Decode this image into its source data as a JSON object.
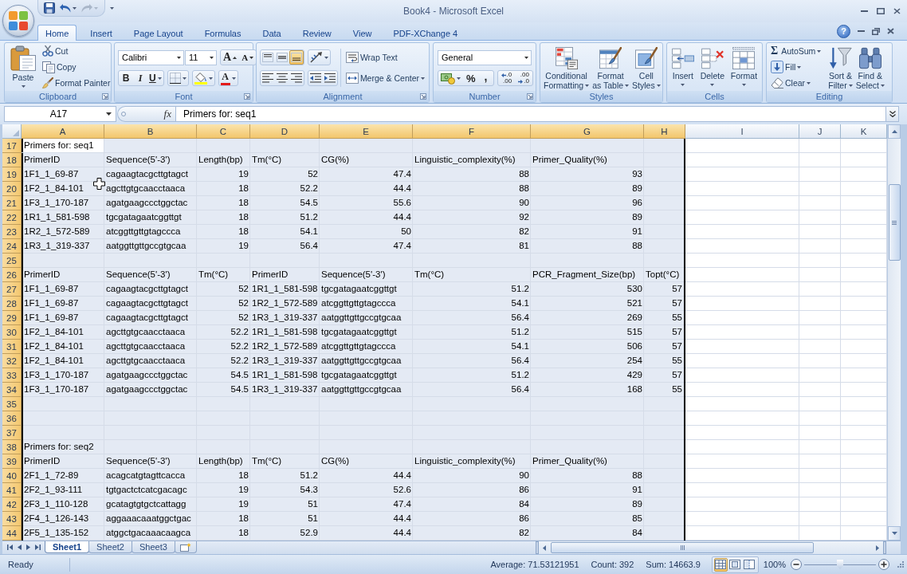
{
  "title_bar": {
    "title": "Book4 - Microsoft Excel"
  },
  "ribbon": {
    "tabs": [
      {
        "label": "Home",
        "selected": true
      },
      {
        "label": "Insert",
        "selected": false
      },
      {
        "label": "Page Layout",
        "selected": false
      },
      {
        "label": "Formulas",
        "selected": false
      },
      {
        "label": "Data",
        "selected": false
      },
      {
        "label": "Review",
        "selected": false
      },
      {
        "label": "View",
        "selected": false
      },
      {
        "label": "PDF-XChange 4",
        "selected": false
      }
    ],
    "help": "?",
    "groups": [
      {
        "kind": "clipboard",
        "label": "Clipboard",
        "paste": "Paste",
        "buttons": [
          {
            "kind": "cut",
            "label": "Cut"
          },
          {
            "kind": "copy",
            "label": "Copy"
          },
          {
            "kind": "painter",
            "label": "Format Painter"
          }
        ]
      },
      {
        "kind": "font",
        "label": "Font",
        "font_name": "Calibri",
        "font_size": "11",
        "grow_font": "A",
        "shrink_font": "A",
        "bold": "B",
        "italic": "I",
        "underline": "U",
        "font_color": "A"
      },
      {
        "kind": "alignment",
        "label": "Alignment",
        "vertical": [
          {
            "kind": "top",
            "selected": false
          },
          {
            "kind": "middle",
            "selected": false
          },
          {
            "kind": "bottom",
            "selected": true
          }
        ],
        "horizontal": [
          {
            "kind": "left",
            "selected": false
          },
          {
            "kind": "center",
            "selected": false
          },
          {
            "kind": "right",
            "selected": false
          }
        ],
        "wrap_text": "Wrap Text",
        "merge": "Merge & Center"
      },
      {
        "kind": "number",
        "label": "Number",
        "format": "General",
        "percent": "%",
        "comma": ",",
        "increase_decimal": [
          ".0",
          ".00"
        ],
        "decrease_decimal": [
          ".00",
          ".0"
        ]
      },
      {
        "kind": "styles",
        "label": "Styles",
        "buttons": [
          {
            "kind": "conditional",
            "lines": [
              "Conditional",
              "Formatting"
            ]
          },
          {
            "kind": "table",
            "lines": [
              "Format",
              "as Table"
            ]
          },
          {
            "kind": "cellstyles",
            "lines": [
              "Cell",
              "Styles"
            ]
          }
        ]
      },
      {
        "kind": "cells",
        "label": "Cells",
        "buttons": [
          {
            "kind": "insert",
            "label": "Insert"
          },
          {
            "kind": "delete",
            "label": "Delete"
          },
          {
            "kind": "format",
            "label": "Format"
          }
        ]
      },
      {
        "kind": "editing",
        "label": "Editing",
        "buttons": [
          {
            "kind": "autosum",
            "symbol": "Σ",
            "label": "AutoSum"
          },
          {
            "kind": "fill",
            "label": "Fill"
          },
          {
            "kind": "clear",
            "label": "Clear"
          }
        ],
        "big_buttons": [
          {
            "kind": "sort",
            "lines": [
              "Sort &",
              "Filter"
            ]
          },
          {
            "kind": "find",
            "lines": [
              "Find &",
              "Select"
            ]
          }
        ]
      }
    ]
  },
  "formula_bar": {
    "name_box": "A17",
    "function_label": "fx",
    "formula": "Primers for: seq1"
  },
  "sheet": {
    "columns": [
      {
        "label": "A",
        "selected": true,
        "active": true
      },
      {
        "label": "B",
        "selected": true,
        "active": false
      },
      {
        "label": "C",
        "selected": true,
        "active": false
      },
      {
        "label": "D",
        "selected": true,
        "active": false
      },
      {
        "label": "E",
        "selected": true,
        "active": false
      },
      {
        "label": "F",
        "selected": true,
        "active": false
      },
      {
        "label": "G",
        "selected": true,
        "active": false
      },
      {
        "label": "H",
        "selected": true,
        "active": false
      },
      {
        "label": "I",
        "selected": false,
        "active": false
      },
      {
        "label": "J",
        "selected": false,
        "active": false
      },
      {
        "label": "K",
        "selected": false,
        "active": false
      }
    ],
    "rows": [
      {
        "number": "17",
        "selected": true,
        "active": true,
        "cells": [
          {
            "text": "Primers for: seq1",
            "kind": "text"
          }
        ]
      },
      {
        "number": "18",
        "selected": true,
        "active": false,
        "cells": [
          {
            "text": "PrimerID",
            "kind": "text"
          },
          {
            "text": "Sequence(5'-3')",
            "kind": "text"
          },
          {
            "text": "Length(bp)",
            "kind": "text"
          },
          {
            "text": "Tm(°C)",
            "kind": "text"
          },
          {
            "text": "CG(%)",
            "kind": "text"
          },
          {
            "text": "Linguistic_complexity(%)",
            "kind": "text"
          },
          {
            "text": "Primer_Quality(%)",
            "kind": "text"
          }
        ]
      },
      {
        "number": "19",
        "selected": true,
        "active": false,
        "cells": [
          {
            "text": "1F1_1_69-87",
            "kind": "text"
          },
          {
            "text": "cagaagtacgcttgtagct",
            "kind": "text"
          },
          {
            "text": "19",
            "kind": "number"
          },
          {
            "text": "52",
            "kind": "number"
          },
          {
            "text": "47.4",
            "kind": "number"
          },
          {
            "text": "88",
            "kind": "number"
          },
          {
            "text": "93",
            "kind": "number"
          }
        ]
      },
      {
        "number": "20",
        "selected": true,
        "active": false,
        "cells": [
          {
            "text": "1F2_1_84-101",
            "kind": "text"
          },
          {
            "text": "agcttgtgcaacctaaca",
            "kind": "text"
          },
          {
            "text": "18",
            "kind": "number"
          },
          {
            "text": "52.2",
            "kind": "number"
          },
          {
            "text": "44.4",
            "kind": "number"
          },
          {
            "text": "88",
            "kind": "number"
          },
          {
            "text": "89",
            "kind": "number"
          }
        ]
      },
      {
        "number": "21",
        "selected": true,
        "active": false,
        "cells": [
          {
            "text": "1F3_1_170-187",
            "kind": "text"
          },
          {
            "text": "agatgaagccctggctac",
            "kind": "text"
          },
          {
            "text": "18",
            "kind": "number"
          },
          {
            "text": "54.5",
            "kind": "number"
          },
          {
            "text": "55.6",
            "kind": "number"
          },
          {
            "text": "90",
            "kind": "number"
          },
          {
            "text": "96",
            "kind": "number"
          }
        ]
      },
      {
        "number": "22",
        "selected": true,
        "active": false,
        "cells": [
          {
            "text": "1R1_1_581-598",
            "kind": "text"
          },
          {
            "text": "tgcgatagaatcggttgt",
            "kind": "text"
          },
          {
            "text": "18",
            "kind": "number"
          },
          {
            "text": "51.2",
            "kind": "number"
          },
          {
            "text": "44.4",
            "kind": "number"
          },
          {
            "text": "92",
            "kind": "number"
          },
          {
            "text": "89",
            "kind": "number"
          }
        ]
      },
      {
        "number": "23",
        "selected": true,
        "active": false,
        "cells": [
          {
            "text": "1R2_1_572-589",
            "kind": "text"
          },
          {
            "text": "atcggttgttgtagccca",
            "kind": "text"
          },
          {
            "text": "18",
            "kind": "number"
          },
          {
            "text": "54.1",
            "kind": "number"
          },
          {
            "text": "50",
            "kind": "number"
          },
          {
            "text": "82",
            "kind": "number"
          },
          {
            "text": "91",
            "kind": "number"
          }
        ]
      },
      {
        "number": "24",
        "selected": true,
        "active": false,
        "cells": [
          {
            "text": "1R3_1_319-337",
            "kind": "text"
          },
          {
            "text": "aatggttgttgccgtgcaa",
            "kind": "text"
          },
          {
            "text": "19",
            "kind": "number"
          },
          {
            "text": "56.4",
            "kind": "number"
          },
          {
            "text": "47.4",
            "kind": "number"
          },
          {
            "text": "81",
            "kind": "number"
          },
          {
            "text": "88",
            "kind": "number"
          }
        ]
      },
      {
        "number": "25",
        "selected": true,
        "active": false
      },
      {
        "number": "26",
        "selected": true,
        "active": false,
        "cells": [
          {
            "text": "PrimerID",
            "kind": "text"
          },
          {
            "text": "Sequence(5'-3')",
            "kind": "text"
          },
          {
            "text": "Tm(°C)",
            "kind": "text"
          },
          {
            "text": "PrimerID",
            "kind": "text"
          },
          {
            "text": "Sequence(5'-3')",
            "kind": "text"
          },
          {
            "text": "Tm(°C)",
            "kind": "text"
          },
          {
            "text": "PCR_Fragment_Size(bp)",
            "kind": "text"
          },
          {
            "text": "Topt(°C)",
            "kind": "text"
          }
        ]
      },
      {
        "number": "27",
        "selected": true,
        "active": false,
        "cells": [
          {
            "text": "1F1_1_69-87",
            "kind": "text"
          },
          {
            "text": "cagaagtacgcttgtagct",
            "kind": "text"
          },
          {
            "text": "52",
            "kind": "number"
          },
          {
            "text": "1R1_1_581-598",
            "kind": "text"
          },
          {
            "text": "tgcgatagaatcggttgt",
            "kind": "text"
          },
          {
            "text": "51.2",
            "kind": "number"
          },
          {
            "text": "530",
            "kind": "number"
          },
          {
            "text": "57",
            "kind": "number"
          }
        ]
      },
      {
        "number": "28",
        "selected": true,
        "active": false,
        "cells": [
          {
            "text": "1F1_1_69-87",
            "kind": "text"
          },
          {
            "text": "cagaagtacgcttgtagct",
            "kind": "text"
          },
          {
            "text": "52",
            "kind": "number"
          },
          {
            "text": "1R2_1_572-589",
            "kind": "text"
          },
          {
            "text": "atcggttgttgtagccca",
            "kind": "text"
          },
          {
            "text": "54.1",
            "kind": "number"
          },
          {
            "text": "521",
            "kind": "number"
          },
          {
            "text": "57",
            "kind": "number"
          }
        ]
      },
      {
        "number": "29",
        "selected": true,
        "active": false,
        "cells": [
          {
            "text": "1F1_1_69-87",
            "kind": "text"
          },
          {
            "text": "cagaagtacgcttgtagct",
            "kind": "text"
          },
          {
            "text": "52",
            "kind": "number"
          },
          {
            "text": "1R3_1_319-337",
            "kind": "text"
          },
          {
            "text": "aatggttgttgccgtgcaa",
            "kind": "text"
          },
          {
            "text": "56.4",
            "kind": "number"
          },
          {
            "text": "269",
            "kind": "number"
          },
          {
            "text": "55",
            "kind": "number"
          }
        ]
      },
      {
        "number": "30",
        "selected": true,
        "active": false,
        "cells": [
          {
            "text": "1F2_1_84-101",
            "kind": "text"
          },
          {
            "text": "agcttgtgcaacctaaca",
            "kind": "text"
          },
          {
            "text": "52.2",
            "kind": "number"
          },
          {
            "text": "1R1_1_581-598",
            "kind": "text"
          },
          {
            "text": "tgcgatagaatcggttgt",
            "kind": "text"
          },
          {
            "text": "51.2",
            "kind": "number"
          },
          {
            "text": "515",
            "kind": "number"
          },
          {
            "text": "57",
            "kind": "number"
          }
        ]
      },
      {
        "number": "31",
        "selected": true,
        "active": false,
        "cells": [
          {
            "text": "1F2_1_84-101",
            "kind": "text"
          },
          {
            "text": "agcttgtgcaacctaaca",
            "kind": "text"
          },
          {
            "text": "52.2",
            "kind": "number"
          },
          {
            "text": "1R2_1_572-589",
            "kind": "text"
          },
          {
            "text": "atcggttgttgtagccca",
            "kind": "text"
          },
          {
            "text": "54.1",
            "kind": "number"
          },
          {
            "text": "506",
            "kind": "number"
          },
          {
            "text": "57",
            "kind": "number"
          }
        ]
      },
      {
        "number": "32",
        "selected": true,
        "active": false,
        "cells": [
          {
            "text": "1F2_1_84-101",
            "kind": "text"
          },
          {
            "text": "agcttgtgcaacctaaca",
            "kind": "text"
          },
          {
            "text": "52.2",
            "kind": "number"
          },
          {
            "text": "1R3_1_319-337",
            "kind": "text"
          },
          {
            "text": "aatggttgttgccgtgcaa",
            "kind": "text"
          },
          {
            "text": "56.4",
            "kind": "number"
          },
          {
            "text": "254",
            "kind": "number"
          },
          {
            "text": "55",
            "kind": "number"
          }
        ]
      },
      {
        "number": "33",
        "selected": true,
        "active": false,
        "cells": [
          {
            "text": "1F3_1_170-187",
            "kind": "text"
          },
          {
            "text": "agatgaagccctggctac",
            "kind": "text"
          },
          {
            "text": "54.5",
            "kind": "number"
          },
          {
            "text": "1R1_1_581-598",
            "kind": "text"
          },
          {
            "text": "tgcgatagaatcggttgt",
            "kind": "text"
          },
          {
            "text": "51.2",
            "kind": "number"
          },
          {
            "text": "429",
            "kind": "number"
          },
          {
            "text": "57",
            "kind": "number"
          }
        ]
      },
      {
        "number": "34",
        "selected": true,
        "active": false,
        "cells": [
          {
            "text": "1F3_1_170-187",
            "kind": "text"
          },
          {
            "text": "agatgaagccctggctac",
            "kind": "text"
          },
          {
            "text": "54.5",
            "kind": "number"
          },
          {
            "text": "1R3_1_319-337",
            "kind": "text"
          },
          {
            "text": "aatggttgttgccgtgcaa",
            "kind": "text"
          },
          {
            "text": "56.4",
            "kind": "number"
          },
          {
            "text": "168",
            "kind": "number"
          },
          {
            "text": "55",
            "kind": "number"
          }
        ]
      },
      {
        "number": "35",
        "selected": true,
        "active": false
      },
      {
        "number": "36",
        "selected": true,
        "active": false
      },
      {
        "number": "37",
        "selected": true,
        "active": false
      },
      {
        "number": "38",
        "selected": true,
        "active": false,
        "cells": [
          {
            "text": "Primers for: seq2",
            "kind": "text"
          }
        ]
      },
      {
        "number": "39",
        "selected": true,
        "active": false,
        "cells": [
          {
            "text": "PrimerID",
            "kind": "text"
          },
          {
            "text": "Sequence(5'-3')",
            "kind": "text"
          },
          {
            "text": "Length(bp)",
            "kind": "text"
          },
          {
            "text": "Tm(°C)",
            "kind": "text"
          },
          {
            "text": "CG(%)",
            "kind": "text"
          },
          {
            "text": "Linguistic_complexity(%)",
            "kind": "text"
          },
          {
            "text": "Primer_Quality(%)",
            "kind": "text"
          }
        ]
      },
      {
        "number": "40",
        "selected": true,
        "active": false,
        "cells": [
          {
            "text": "2F1_1_72-89",
            "kind": "text"
          },
          {
            "text": "acagcatgtagttcacca",
            "kind": "text"
          },
          {
            "text": "18",
            "kind": "number"
          },
          {
            "text": "51.2",
            "kind": "number"
          },
          {
            "text": "44.4",
            "kind": "number"
          },
          {
            "text": "90",
            "kind": "number"
          },
          {
            "text": "88",
            "kind": "number"
          }
        ]
      },
      {
        "number": "41",
        "selected": true,
        "active": false,
        "cells": [
          {
            "text": "2F2_1_93-111",
            "kind": "text"
          },
          {
            "text": "tgtgactctcatcgacagc",
            "kind": "text"
          },
          {
            "text": "19",
            "kind": "number"
          },
          {
            "text": "54.3",
            "kind": "number"
          },
          {
            "text": "52.6",
            "kind": "number"
          },
          {
            "text": "86",
            "kind": "number"
          },
          {
            "text": "91",
            "kind": "number"
          }
        ]
      },
      {
        "number": "42",
        "selected": true,
        "active": false,
        "cells": [
          {
            "text": "2F3_1_110-128",
            "kind": "text"
          },
          {
            "text": "gcatagtgtgctcattagg",
            "kind": "text"
          },
          {
            "text": "19",
            "kind": "number"
          },
          {
            "text": "51",
            "kind": "number"
          },
          {
            "text": "47.4",
            "kind": "number"
          },
          {
            "text": "84",
            "kind": "number"
          },
          {
            "text": "89",
            "kind": "number"
          }
        ]
      },
      {
        "number": "43",
        "selected": true,
        "active": false,
        "cells": [
          {
            "text": "2F4_1_126-143",
            "kind": "text"
          },
          {
            "text": "aggaaacaaatggctgac",
            "kind": "text"
          },
          {
            "text": "18",
            "kind": "number"
          },
          {
            "text": "51",
            "kind": "number"
          },
          {
            "text": "44.4",
            "kind": "number"
          },
          {
            "text": "86",
            "kind": "number"
          },
          {
            "text": "85",
            "kind": "number"
          }
        ]
      },
      {
        "number": "44",
        "selected": true,
        "active": false,
        "cells": [
          {
            "text": "2F5_1_135-152",
            "kind": "text"
          },
          {
            "text": "atggctgacaaacaagca",
            "kind": "text"
          },
          {
            "text": "18",
            "kind": "number"
          },
          {
            "text": "52.9",
            "kind": "number"
          },
          {
            "text": "44.4",
            "kind": "number"
          },
          {
            "text": "82",
            "kind": "number"
          },
          {
            "text": "84",
            "kind": "number"
          }
        ]
      }
    ]
  },
  "sheet_tabs": [
    {
      "label": "Sheet1",
      "selected": true
    },
    {
      "label": "Sheet2",
      "selected": false
    },
    {
      "label": "Sheet3",
      "selected": false
    }
  ],
  "status_bar": {
    "mode": "Ready",
    "average": "Average: 71.53121951",
    "count": "Count: 392",
    "sum": "Sum: 14663.9",
    "views": [
      {
        "kind": "normal",
        "selected": true
      },
      {
        "kind": "layout",
        "selected": false
      },
      {
        "kind": "pagebreak",
        "selected": false
      }
    ],
    "zoom": {
      "label": "100%",
      "level": 0.5
    }
  }
}
